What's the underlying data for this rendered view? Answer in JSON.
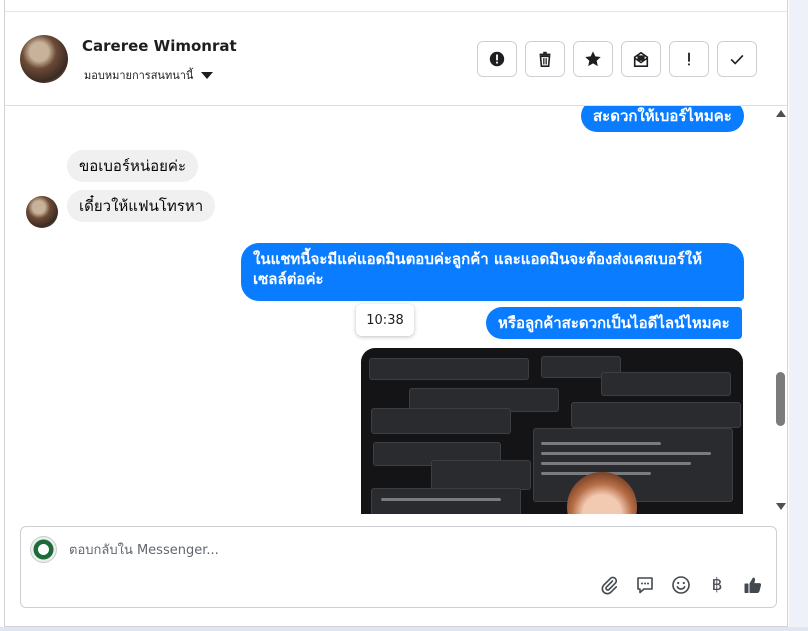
{
  "header": {
    "contact_name": "Careree Wimonrat",
    "assign_label": "มอบหมายการสนทนานี้"
  },
  "toolbar": {
    "buttons": [
      {
        "name": "report-button",
        "icon": "alert-circle-icon"
      },
      {
        "name": "delete-button",
        "icon": "trash-icon"
      },
      {
        "name": "star-button",
        "icon": "star-icon"
      },
      {
        "name": "mark-unread-button",
        "icon": "envelope-icon"
      },
      {
        "name": "mark-important-button",
        "icon": "exclamation-icon"
      },
      {
        "name": "done-button",
        "icon": "check-icon"
      }
    ]
  },
  "messages": {
    "m1": "สะดวกให้เบอร์ไหมคะ",
    "m2": "ขอเบอร์หน่อยค่ะ",
    "m3": "เดี๋ยวให้แฟนโทรหา",
    "m4_line1": "ในแชทนี้จะมีแค่แอดมินตอบค่ะลูกค้า และแอดมินจะต้องส่งเคสเบอร์ให้",
    "m4_line2": "เซลล์ต่อค่ะ",
    "time_tooltip": "10:38",
    "m5": "หรือลูกค้าสะดวกเป็นไอดีไลน์ไหมคะ"
  },
  "composer": {
    "placeholder": "ตอบกลับใน Messenger...",
    "baht_symbol": "฿"
  },
  "colors": {
    "outgoing_bubble": "#0a7cff",
    "incoming_bubble": "#f0f0f0",
    "like_icon": "#444950"
  }
}
